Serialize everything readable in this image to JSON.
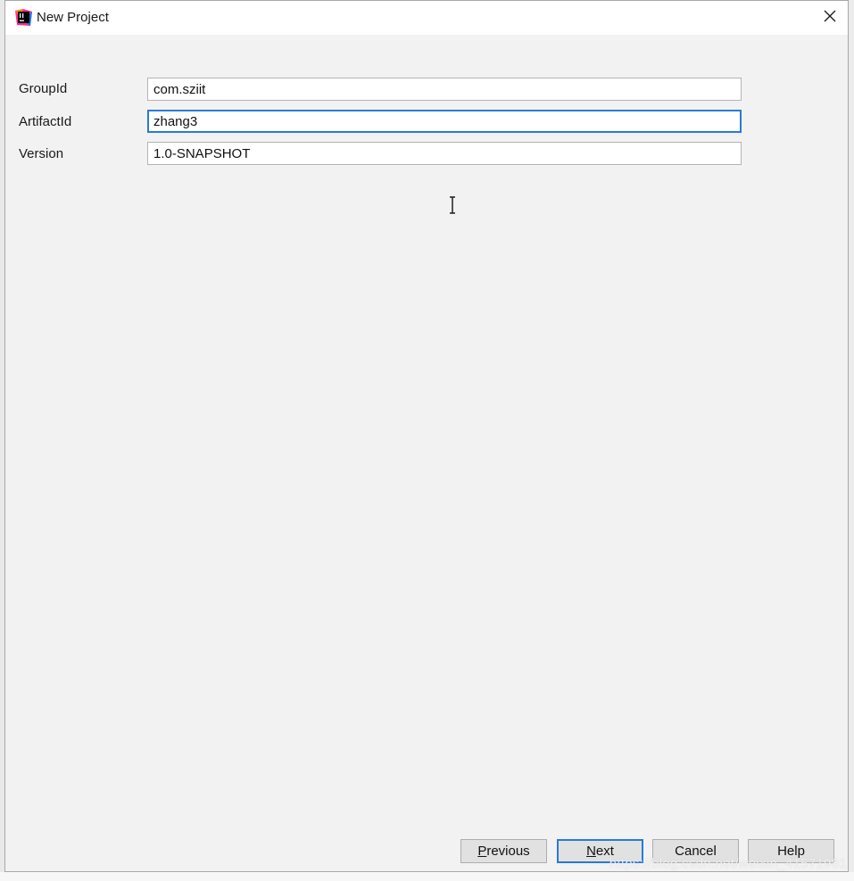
{
  "dialog": {
    "title": "New Project",
    "icons": {
      "app": "intellij-idea-icon",
      "close": "close-icon",
      "cursor": "text-cursor-icon"
    }
  },
  "form": {
    "fields": [
      {
        "label": "GroupId",
        "value": "com.sziit"
      },
      {
        "label": "ArtifactId",
        "value": "zhang3"
      },
      {
        "label": "Version",
        "value": "1.0-SNAPSHOT"
      }
    ]
  },
  "buttons": {
    "previous": {
      "mnemonic": "P",
      "rest": "revious"
    },
    "next": {
      "mnemonic": "N",
      "rest": "ext"
    },
    "cancel": "Cancel",
    "help": "Help"
  },
  "watermark": "https://blog.csdn.net/weixin_41571981",
  "colors": {
    "focus": "#2a7ad6",
    "background": "#f2f2f2"
  }
}
